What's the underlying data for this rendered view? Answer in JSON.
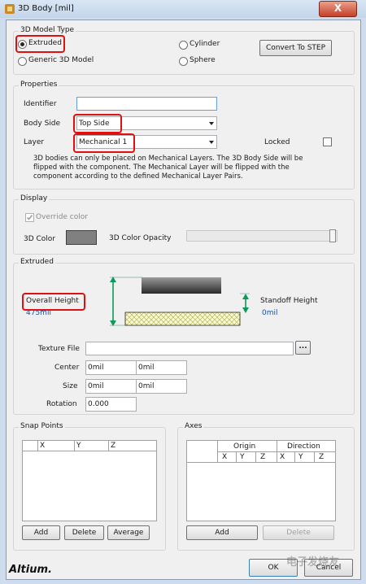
{
  "window": {
    "title": "3D Body [mil]",
    "close_label": "X"
  },
  "model_type": {
    "group_title": "3D Model Type",
    "extruded": "Extruded",
    "generic": "Generic 3D Model",
    "cylinder": "Cylinder",
    "sphere": "Sphere",
    "selected": "Extruded",
    "convert_button": "Convert To STEP"
  },
  "properties": {
    "group_title": "Properties",
    "identifier_label": "Identifier",
    "identifier_value": "",
    "body_side_label": "Body Side",
    "body_side_value": "Top Side",
    "layer_label": "Layer",
    "layer_value": "Mechanical 1",
    "locked_label": "Locked",
    "locked_checked": false,
    "note_line1": "3D bodies can only be placed on Mechanical Layers. The 3D Body Side will be",
    "note_line2": "flipped with the component. The Mechanical Layer will be flipped with the",
    "note_line3": "component according to the defined Mechanical Layer Pairs."
  },
  "display": {
    "group_title": "Display",
    "override_label": "Override color",
    "override_checked": true,
    "color_label": "3D Color",
    "color_value": "#808080",
    "opacity_label": "3D Color Opacity",
    "opacity_level": 1.0
  },
  "extruded": {
    "group_title": "Extruded",
    "overall_height_label": "Overall Height",
    "overall_height_value": "475mil",
    "standoff_label": "Standoff Height",
    "standoff_value": "0mil",
    "texture_label": "Texture File",
    "texture_value": "",
    "browse_label": "...",
    "center_label": "Center",
    "center_x": "0mil",
    "center_y": "0mil",
    "size_label": "Size",
    "size_x": "0mil",
    "size_y": "0mil",
    "rotation_label": "Rotation",
    "rotation_value": "0.000"
  },
  "snap_points": {
    "group_title": "Snap Points",
    "columns": [
      "X",
      "Y",
      "Z"
    ],
    "add_button": "Add",
    "delete_button": "Delete",
    "average_button": "Average"
  },
  "axes": {
    "group_title": "Axes",
    "header_origin": "Origin",
    "header_direction": "Direction",
    "columns": [
      "X",
      "Y",
      "Z",
      "X",
      "Y",
      "Z"
    ],
    "add_button": "Add",
    "delete_button": "Delete"
  },
  "footer": {
    "brand": "Altium.",
    "ok_button": "OK",
    "cancel_button": "Cancel",
    "watermark": "电子发烧友"
  },
  "colors": {
    "annotation_red": "#e01010",
    "arrow_green": "#0a9a5a",
    "value_blue": "#1a4fa8"
  }
}
